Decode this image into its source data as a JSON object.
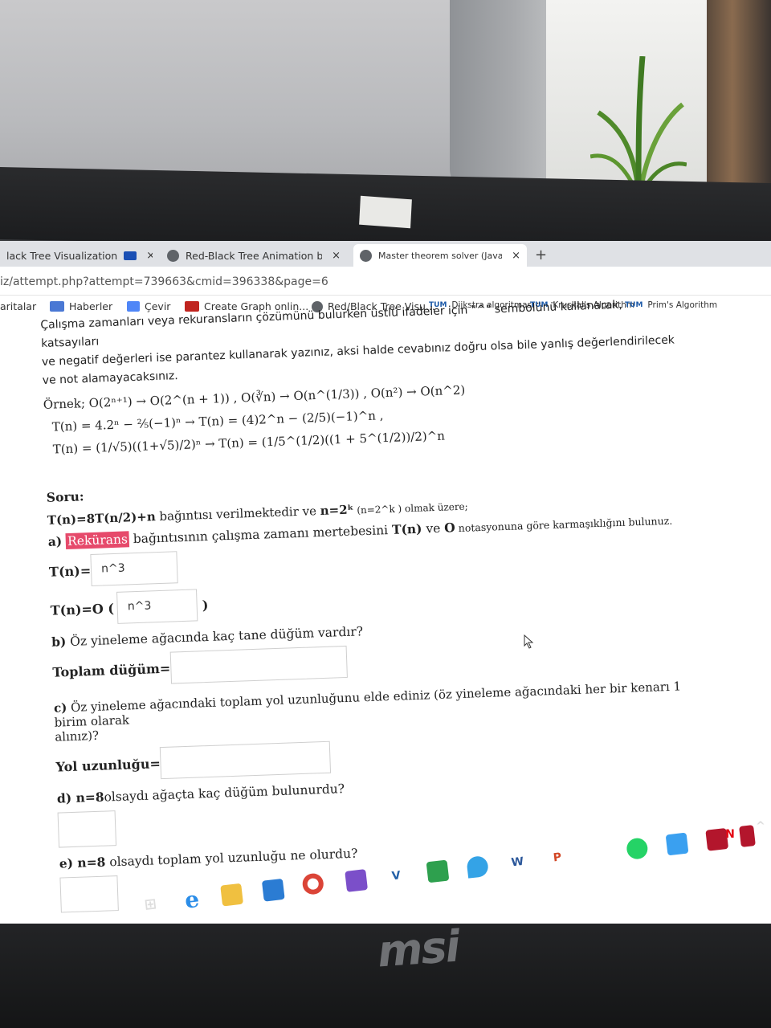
{
  "tabs": [
    {
      "title": "lack Tree Visualization",
      "active": false
    },
    {
      "title": "Red-Black Tree Animation by Y. D",
      "active": false
    },
    {
      "title": "Master theorem solver (JavaScrip",
      "active": true
    }
  ],
  "new_tab": "+",
  "close_glyph": "×",
  "address": "iz/attempt.php?attempt=739663&cmid=396338&page=6",
  "bookmarks": [
    {
      "label": "aritalar",
      "icon": "none"
    },
    {
      "label": "Haberler",
      "icon": "news-icon"
    },
    {
      "label": "Çevir",
      "icon": "translate-icon"
    },
    {
      "label": "Create Graph onlin...",
      "icon": "graph-icon"
    },
    {
      "label": "Red/Black Tree Visu...",
      "icon": "globe-icon"
    },
    {
      "label": "Dijkstra algoritması",
      "icon": "tum-icon"
    },
    {
      "label": "Kruskal's Algorithm",
      "icon": "tum-icon"
    },
    {
      "label": "Prim's Algorithm",
      "icon": "tum-icon"
    }
  ],
  "bookmark_badge": "TUM",
  "intro": {
    "line1": "Çalışma zamanları veya rekuransların çözümünü bulurken üstlü ifadeler için \"^\" sembolünü kullanarak, katsayıları",
    "line2": "ve negatif değerleri ise parantez kullanarak yazınız, aksi halde cevabınız doğru olsa bile yanlış değerlendirilecek",
    "line3": "ve not alamayacaksınız."
  },
  "example": {
    "line1": "Örnek; O(2ⁿ⁺¹) → O(2^(n + 1)) ,  O(∛n) → O(n^(1/3)) , O(n²) → O(n^2)",
    "line2": "T(n) = 4.2ⁿ − ²⁄₅(−1)ⁿ → T(n) = (4)2^n − (2/5)(−1)^n ,",
    "line3": "T(n) = (1/√5)((1+√5)/2)ⁿ → T(n) = (1/5^(1/2)((1 + 5^(1/2))/2)^n"
  },
  "question": {
    "heading": "Soru:",
    "recurrence": "T(n)=8T(n/2)+n",
    "text1": " bağıntısı verilmektedir ve ",
    "n_def": "n=2ᵏ",
    "n_def_alt": " (n=2^k ) ",
    "text2": "olmak üzere;",
    "line2_prefix": "notasyonuna göre karmaşıklığını bulunuz.",
    "a_label": "a)",
    "a_highlight": "Rekürans",
    "a_text": " bağıntısının çalışma zamanı mertebesini ",
    "a_tn": "T(n)",
    "a_ve": " ve ",
    "a_o": "O",
    "a_tail": " notasyonuna göre karmaşıklığını bulunuz.",
    "tn_label": "T(n)=",
    "tn_value": "n^3",
    "on_label": "T(n)=O (",
    "on_value": "n^3",
    "on_close": ")",
    "b_label": "b)",
    "b_text": " Öz yineleme ağacında kaç tane düğüm vardır?",
    "b_field": "Toplam düğüm=",
    "b_value": "",
    "c_label": "c)",
    "c_text": " Öz yineleme ağacındaki toplam yol uzunluğunu elde ediniz (öz yineleme ağacındaki her bir kenarı 1 birim olarak",
    "c_text2": "alınız)?",
    "c_field": "Yol uzunluğu=",
    "c_value": "",
    "d_label": "d) n=8",
    "d_text": "olsaydı ağaçta kaç düğüm bulunurdu?",
    "d_value": "",
    "e_label": "e) n=8",
    "e_text": " olsaydı toplam yol uzunluğu ne olurdu?",
    "e_value": ""
  },
  "taskbar": {
    "icons": [
      "task-view-icon",
      "edge-icon",
      "file-explorer-icon",
      "mail-icon",
      "chrome-icon",
      "visual-studio-icon",
      "vs-code-icon",
      "snip-icon",
      "paint-icon",
      "word-icon",
      "powerpoint-icon",
      "itunes-icon",
      "whatsapp-icon",
      "instagram-icon",
      "app-icon",
      "app2-icon",
      "netflix-icon"
    ],
    "tray_chevron": "^",
    "word_letter": "W",
    "ppt_letter": "P",
    "vs_letter": "V",
    "netflix_letter": "N",
    "edge_letter": "e"
  },
  "laptop_brand": "msi",
  "colors": {
    "highlight": "#e64a6b",
    "tab_bar": "#dfe1e5"
  }
}
